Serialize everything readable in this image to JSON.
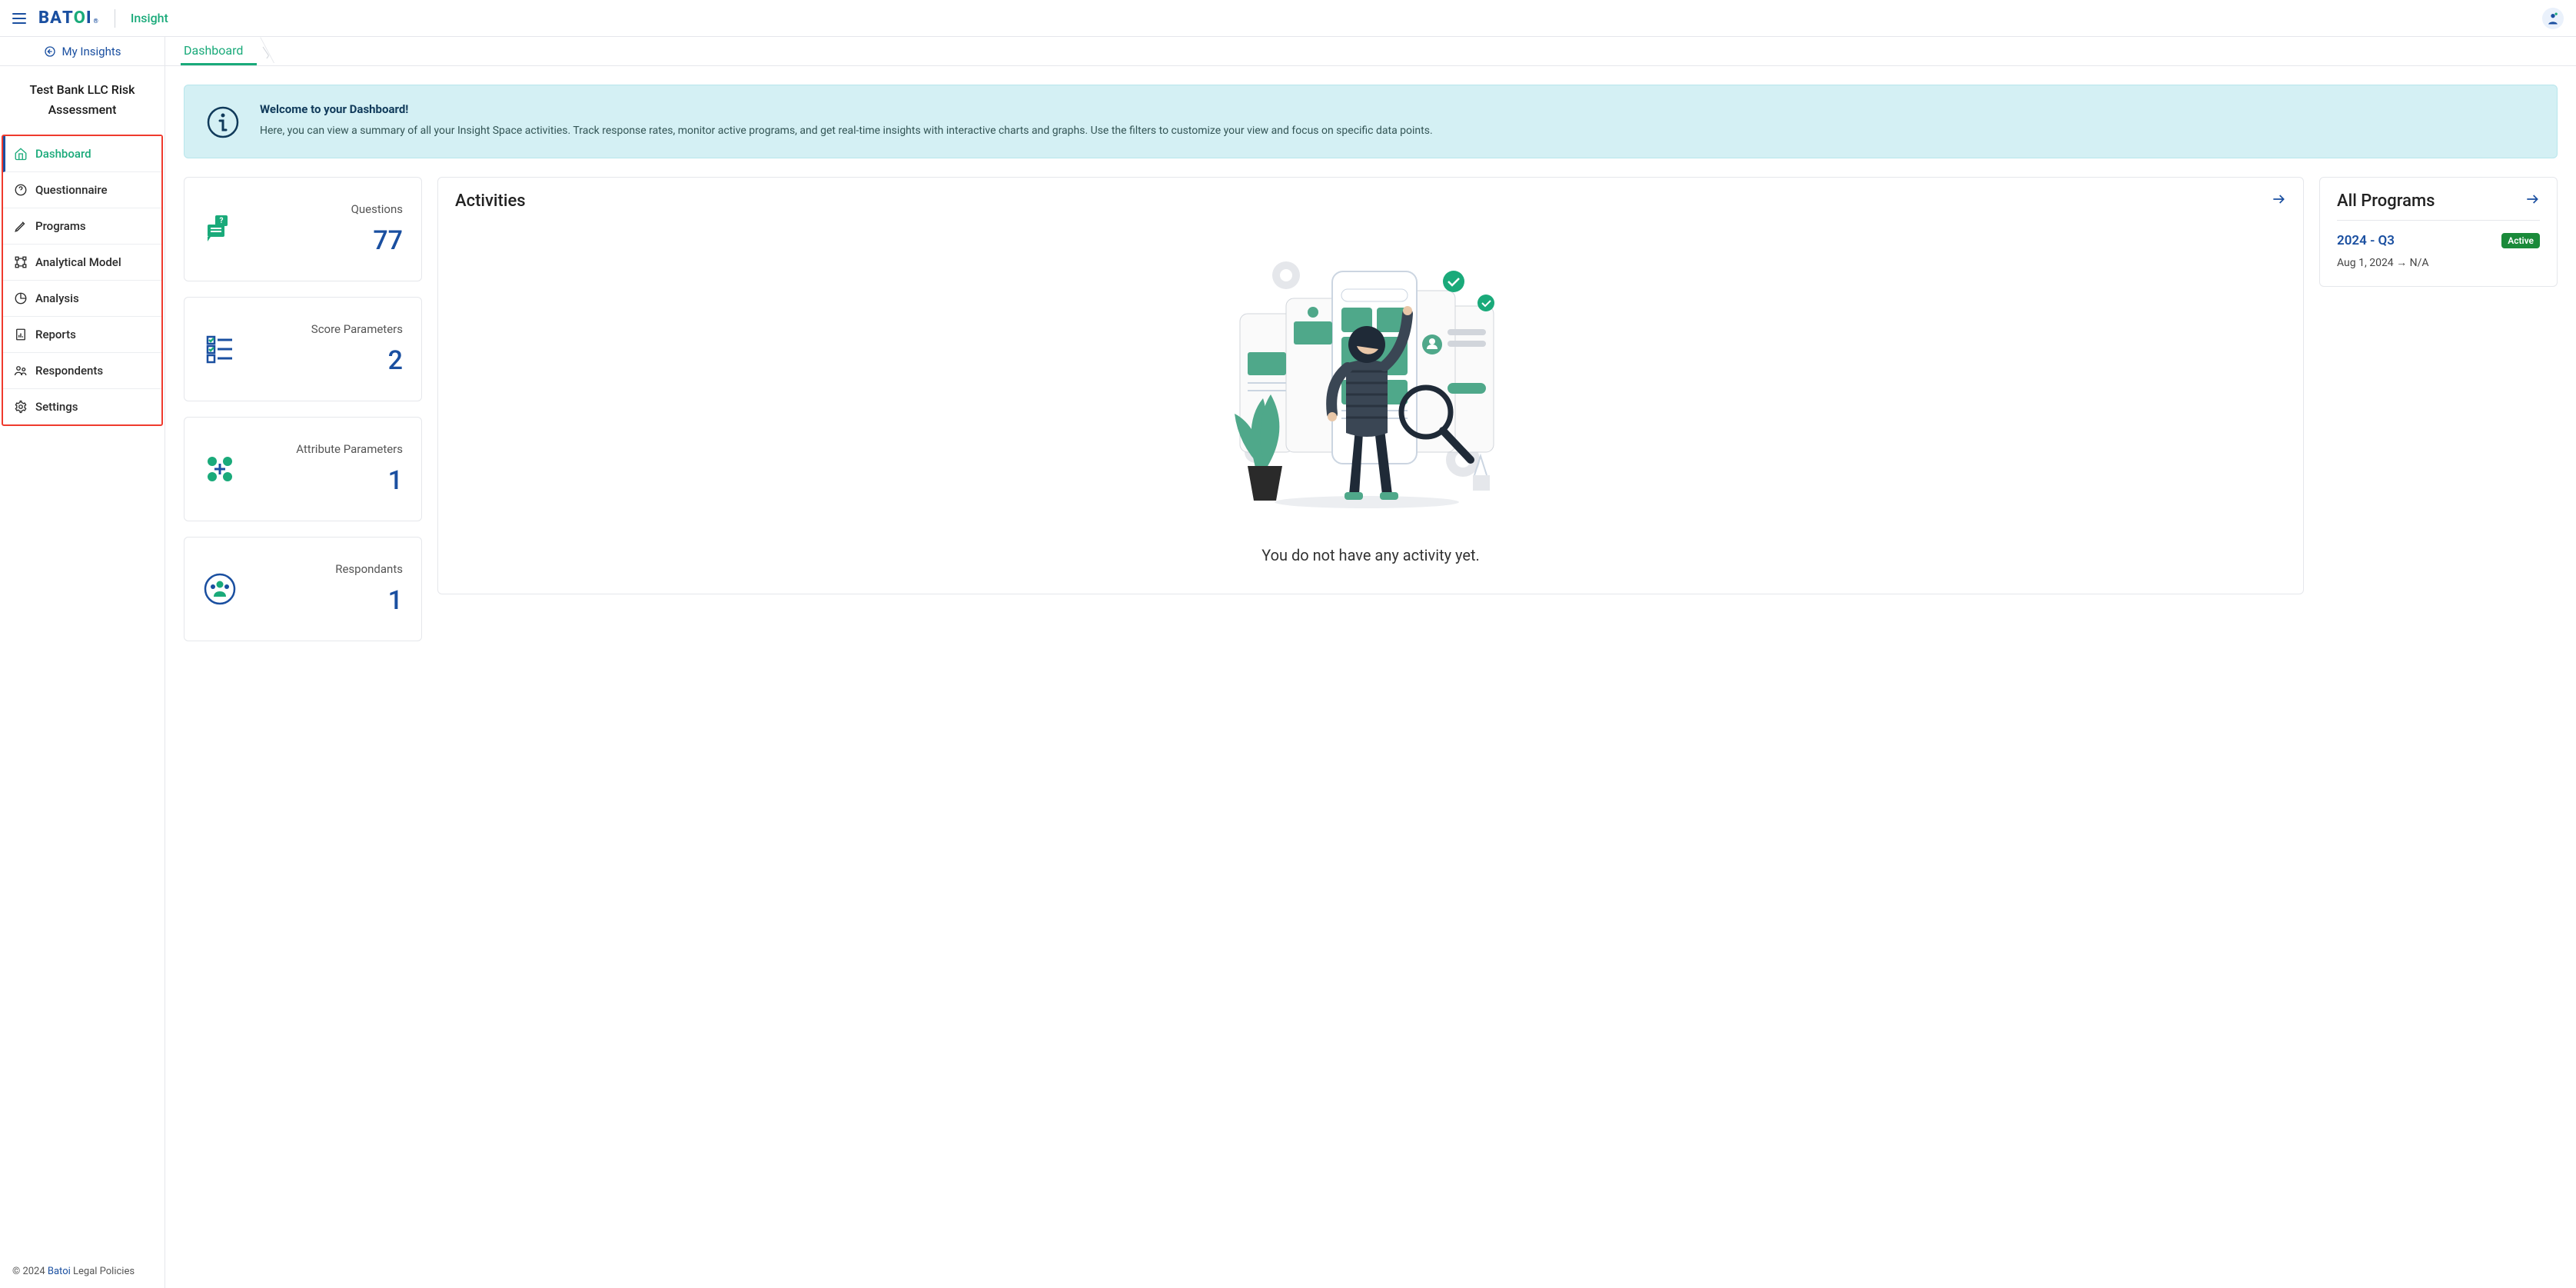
{
  "header": {
    "logo_text": "BATOI",
    "product": "Insight"
  },
  "crumb": {
    "back": "My Insights",
    "tab": "Dashboard"
  },
  "sidebar": {
    "space_name": "Test Bank LLC Risk Assessment",
    "items": [
      {
        "label": "Dashboard"
      },
      {
        "label": "Questionnaire"
      },
      {
        "label": "Programs"
      },
      {
        "label": "Analytical Model"
      },
      {
        "label": "Analysis"
      },
      {
        "label": "Reports"
      },
      {
        "label": "Respondents"
      },
      {
        "label": "Settings"
      }
    ],
    "footer_prefix": "© 2024 ",
    "footer_link1": "Batoi",
    "footer_mid": " ",
    "footer_link2": "Legal Policies"
  },
  "banner": {
    "title": "Welcome to your Dashboard!",
    "text": "Here, you can view a summary of all your Insight Space activities. Track response rates, monitor active programs, and get real-time insights with interactive charts and graphs. Use the filters to customize your view and focus on specific data points."
  },
  "stats": [
    {
      "label": "Questions",
      "value": "77"
    },
    {
      "label": "Score Parameters",
      "value": "2"
    },
    {
      "label": "Attribute Parameters",
      "value": "1"
    },
    {
      "label": "Respondants",
      "value": "1"
    }
  ],
  "activities": {
    "title": "Activities",
    "empty": "You do not have any activity yet."
  },
  "programs_panel": {
    "title": "All Programs",
    "items": [
      {
        "name": "2024 - Q3",
        "status": "Active",
        "dates": "Aug 1, 2024 → N/A"
      }
    ]
  }
}
